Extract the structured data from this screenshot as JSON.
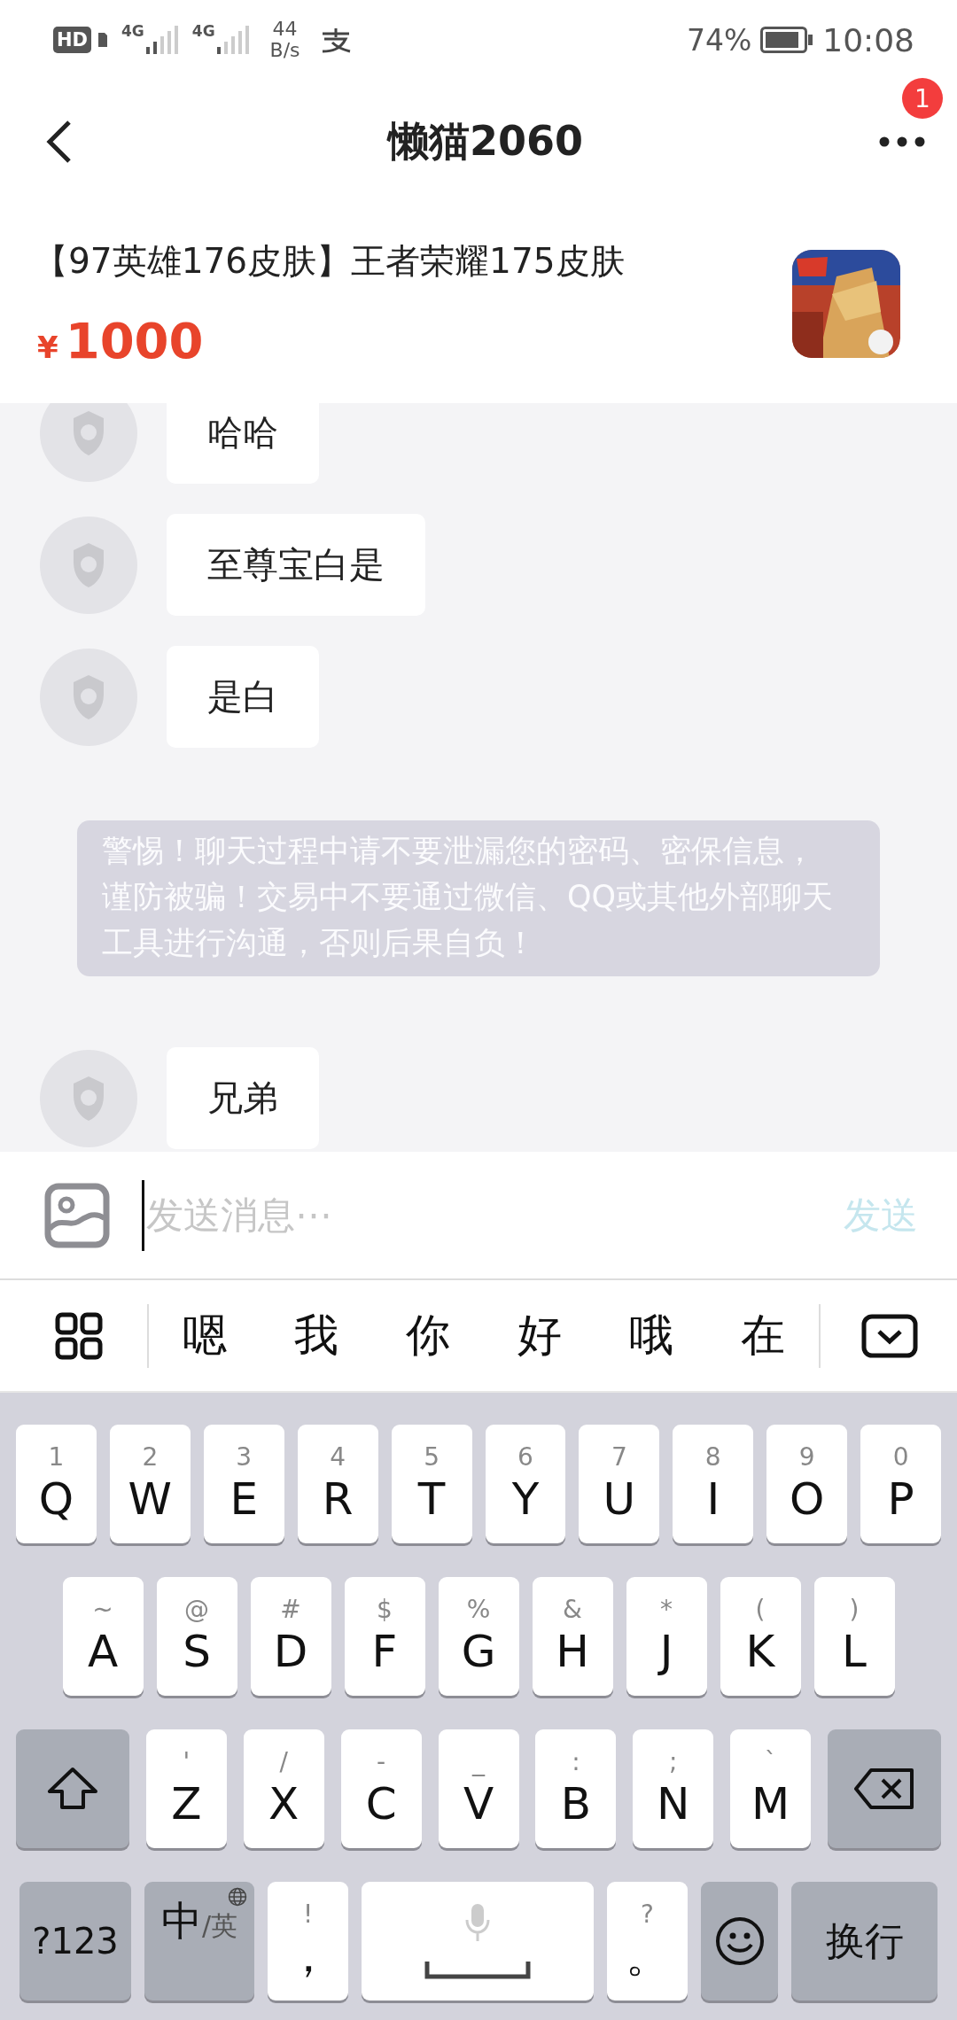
{
  "status_bar": {
    "hd": "HD",
    "networks": [
      "4G",
      "4G"
    ],
    "speed": "44",
    "speed_unit": "B/s",
    "battery": "74%",
    "time": "10:08"
  },
  "header": {
    "title": "懒猫2060",
    "badge": "1"
  },
  "product": {
    "title": "【97英雄176皮肤】王者荣耀175皮肤",
    "currency": "¥",
    "price": "1000"
  },
  "messages": [
    {
      "kind": "message",
      "text": "哈哈"
    },
    {
      "kind": "message",
      "text": "至尊宝白是"
    },
    {
      "kind": "message",
      "text": "是白"
    },
    {
      "kind": "notice",
      "text": "警惕！聊天过程中请不要泄漏您的密码、密保信息，谨防被骗！交易中不要通过微信、QQ或其他外部聊天工具进行沟通，否则后果自负！"
    },
    {
      "kind": "message",
      "text": "兄弟"
    }
  ],
  "input": {
    "placeholder": "发送消息⋯",
    "send": "发送",
    "send_disabled": true
  },
  "suggestions": [
    "嗯",
    "我",
    "你",
    "好",
    "哦",
    "在"
  ],
  "keyboard": [
    [
      {
        "kind": "char",
        "hint": "1",
        "label": "Q"
      },
      {
        "kind": "char",
        "hint": "2",
        "label": "W"
      },
      {
        "kind": "char",
        "hint": "3",
        "label": "E"
      },
      {
        "kind": "char",
        "hint": "4",
        "label": "R"
      },
      {
        "kind": "char",
        "hint": "5",
        "label": "T"
      },
      {
        "kind": "char",
        "hint": "6",
        "label": "Y"
      },
      {
        "kind": "char",
        "hint": "7",
        "label": "U"
      },
      {
        "kind": "char",
        "hint": "8",
        "label": "I"
      },
      {
        "kind": "char",
        "hint": "9",
        "label": "O"
      },
      {
        "kind": "char",
        "hint": "0",
        "label": "P"
      }
    ],
    [
      {
        "kind": "char",
        "hint": "~",
        "label": "A"
      },
      {
        "kind": "char",
        "hint": "@",
        "label": "S"
      },
      {
        "kind": "char",
        "hint": "#",
        "label": "D"
      },
      {
        "kind": "char",
        "hint": "$",
        "label": "F"
      },
      {
        "kind": "char",
        "hint": "%",
        "label": "G"
      },
      {
        "kind": "char",
        "hint": "&",
        "label": "H"
      },
      {
        "kind": "char",
        "hint": "*",
        "label": "J"
      },
      {
        "kind": "char",
        "hint": "(",
        "label": "K"
      },
      {
        "kind": "char",
        "hint": ")",
        "label": "L"
      }
    ],
    [
      {
        "kind": "shift"
      },
      {
        "kind": "char",
        "hint": "'",
        "label": "Z"
      },
      {
        "kind": "char",
        "hint": "/",
        "label": "X"
      },
      {
        "kind": "char",
        "hint": "-",
        "label": "C"
      },
      {
        "kind": "char",
        "hint": "_",
        "label": "V"
      },
      {
        "kind": "char",
        "hint": ":",
        "label": "B"
      },
      {
        "kind": "char",
        "hint": ";",
        "label": "N"
      },
      {
        "kind": "char",
        "hint": "`",
        "label": "M"
      },
      {
        "kind": "backspace"
      }
    ],
    [
      {
        "kind": "mode",
        "label": "?123"
      },
      {
        "kind": "lang",
        "label": "中",
        "sub": "/英"
      },
      {
        "kind": "char",
        "hint": "!",
        "label": "，"
      },
      {
        "kind": "space"
      },
      {
        "kind": "char",
        "hint": "?",
        "label": "。"
      },
      {
        "kind": "emoji"
      },
      {
        "kind": "enter",
        "label": "换行"
      }
    ]
  ]
}
